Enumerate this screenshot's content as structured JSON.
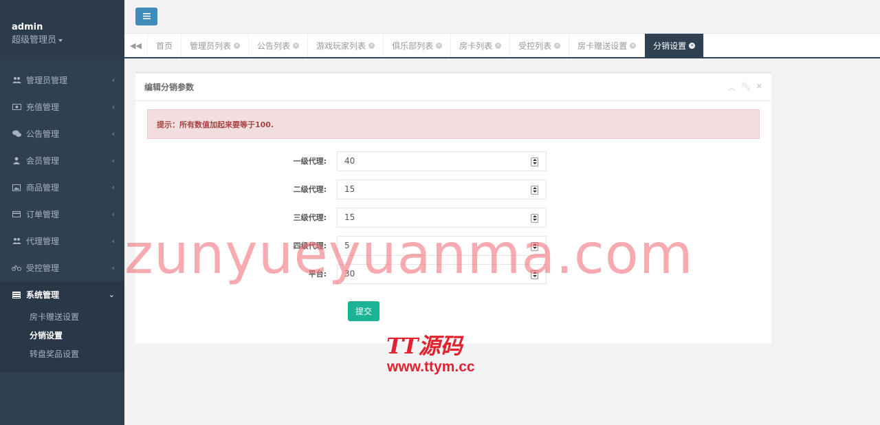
{
  "profile": {
    "username": "admin",
    "role": "超级管理员"
  },
  "sidebar": {
    "items": [
      {
        "label": "管理员管理",
        "icon": "users-icon"
      },
      {
        "label": "充值管理",
        "icon": "money-icon"
      },
      {
        "label": "公告管理",
        "icon": "comments-icon"
      },
      {
        "label": "会员管理",
        "icon": "user-icon"
      },
      {
        "label": "商品管理",
        "icon": "picture-icon"
      },
      {
        "label": "订单管理",
        "icon": "credit-card-icon"
      },
      {
        "label": "代理管理",
        "icon": "users-icon"
      },
      {
        "label": "受控管理",
        "icon": "bicycle-icon"
      },
      {
        "label": "系统管理",
        "icon": "list-icon"
      }
    ],
    "submenu": [
      "房卡赠送设置",
      "分销设置",
      "转盘奖品设置"
    ]
  },
  "tabs": [
    "首页",
    "管理员列表",
    "公告列表",
    "游戏玩家列表",
    "俱乐部列表",
    "房卡列表",
    "受控列表",
    "房卡赠送设置",
    "分销设置"
  ],
  "panel": {
    "title": "编辑分销参数",
    "alert": "提示：所有数值加起来要等于100.",
    "fields": [
      {
        "label": "一级代理:",
        "value": "40"
      },
      {
        "label": "二级代理:",
        "value": "15"
      },
      {
        "label": "三级代理:",
        "value": "15"
      },
      {
        "label": "四级代理:",
        "value": "5"
      },
      {
        "label": "平台:",
        "value": "30"
      }
    ],
    "submit_label": "提交"
  },
  "watermark": {
    "site": "zunyueyuanma.com",
    "logo": "TT源码",
    "logo_url": "www.ttym.cc"
  },
  "colors": {
    "sidebar": "#2f4050",
    "accent": "#1ab394",
    "toggle": "#3e8ab8",
    "alert_bg": "#f2dede",
    "alert_text": "#a94442"
  }
}
